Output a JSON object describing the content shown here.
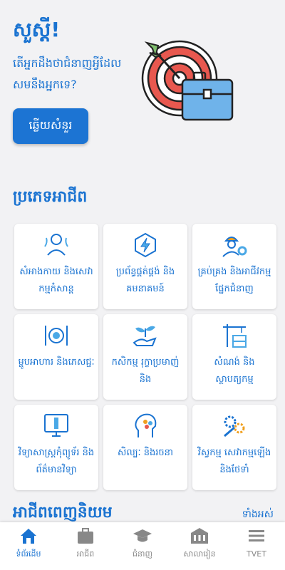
{
  "hero": {
    "greeting": "សួស្ដី!",
    "question": "តើអ្នកដឹងថាជំនាញអ្វីដែលសមនឹងអ្នកទេ?",
    "answer_button": "ឆ្លើយសំនួរ",
    "illustration_icon": "target-briefcase-icon"
  },
  "categories_section": {
    "title": "ប្រភេទអាជីព",
    "items": [
      {
        "label": "សំអាងកាយ និងសេវាកម្មកំសាន្ត",
        "icon": "beauty-icon"
      },
      {
        "label": "ប្រព័ន្ធផ្គត់ផ្គង់ និងគមនាគមន៍",
        "icon": "electric-chip-icon"
      },
      {
        "label": "គ្រប់គ្រង និងអាជីវកម្មផ្នែកជំនាញ",
        "icon": "engineer-gear-icon"
      },
      {
        "label": "ម្ហូបអាហារ និងភេសជ្ជៈ",
        "icon": "food-plate-icon"
      },
      {
        "label": "កសិកម្ម រុក្ខាប្រមាញ់ និង",
        "icon": "plant-hand-icon"
      },
      {
        "label": "សំណង់ និងស្ថាបត្យកម្ម",
        "icon": "construction-crane-icon"
      },
      {
        "label": "វិទ្យាសាស្ត្រកុំព្យូទ័រ និងព័ត៌មានវិទ្យា",
        "icon": "computer-info-icon"
      },
      {
        "label": "សិល្បៈ និងរចនា",
        "icon": "creative-head-icon"
      },
      {
        "label": "វិស្វកម្ម សេវាកម្មឡើង និងថែទាំ",
        "icon": "gears-wrench-icon"
      }
    ]
  },
  "popular_section": {
    "title": "អាជីពពេញនិយម",
    "see_all": "ទាំងអស់"
  },
  "bottom_nav": [
    {
      "label": "ទំព័រដើម",
      "icon": "home-icon",
      "active": true
    },
    {
      "label": "អាជីព",
      "icon": "briefcase-icon",
      "active": false
    },
    {
      "label": "ជំនាញ",
      "icon": "graduation-cap-icon",
      "active": false
    },
    {
      "label": "សាលារៀន",
      "icon": "school-icon",
      "active": false
    },
    {
      "label": "TVET",
      "icon": "menu-icon",
      "active": false
    }
  ],
  "colors": {
    "primary": "#1a73d1",
    "background": "#f2f2f4",
    "target_red": "#e8584f",
    "briefcase_blue": "#6fb3ea"
  }
}
